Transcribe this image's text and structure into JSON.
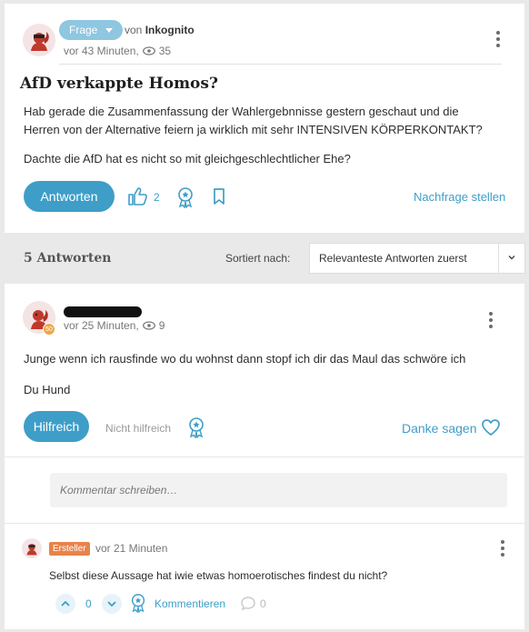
{
  "question": {
    "badge": "Frage",
    "by_prefix": "von",
    "author": "Inkognito",
    "time": "vor 43 Minuten,",
    "views": "35",
    "title": "AfD verkappte Homos?",
    "body_line1": "Hab gerade die Zusammenfassung der Wahlergebnnisse gestern geschaut und die",
    "body_line2": "Herren von der Alternative feiern ja wirklich mit sehr INTENSIVEN KÖRPERKONTAKT?",
    "body_line3": "Dachte die AfD hat es nicht so mit gleichgeschlechtlicher Ehe?",
    "answer_button": "Antworten",
    "likes": "2",
    "follow_up_link": "Nachfrage stellen"
  },
  "answers_bar": {
    "count_label": "5 Antworten",
    "sort_label": "Sortiert nach:",
    "sort_value": "Relevanteste Antworten zuerst"
  },
  "answer": {
    "level": "50",
    "time": "vor 25 Minuten,",
    "views": "9",
    "body_line1": "Junge wenn ich rausfinde wo du wohnst dann stopf ich dir das Maul das schwöre ich",
    "body_line2": "Du Hund",
    "helpful_button": "Hilfreich",
    "not_helpful_button": "Nicht hilfreich",
    "thanks_link": "Danke sagen",
    "comment_placeholder": "Kommentar schreiben…"
  },
  "comment": {
    "badge": "Ersteller",
    "time": "vor 21 Minuten",
    "body": "Selbst diese Aussage hat iwie etwas homoerotisches findest du nicht?",
    "votes": "0",
    "comment_link": "Kommentieren",
    "replies": "0"
  },
  "colors": {
    "accent": "#3e9ec8",
    "badge": "#8fc6e0",
    "ersteller": "#e8834a"
  },
  "icons": [
    "squirrel-avatar-icon",
    "eye-icon",
    "thumbs-up-icon",
    "award-icon",
    "bookmark-icon",
    "heart-icon",
    "chevron-down-icon",
    "chevron-up-icon",
    "comment-bubble-icon",
    "kebab-menu-icon"
  ]
}
